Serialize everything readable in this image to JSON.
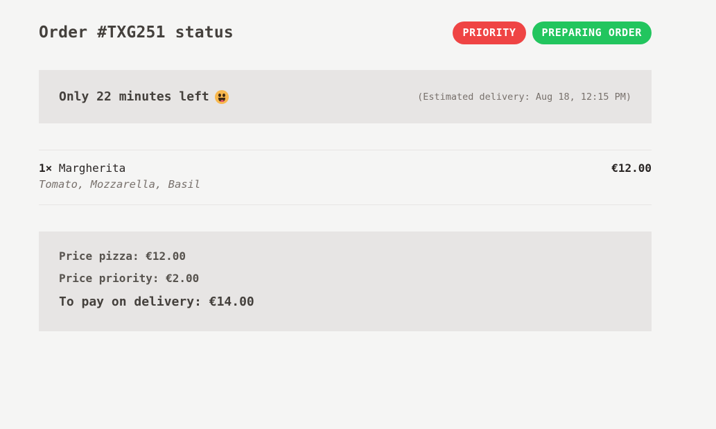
{
  "header": {
    "title": "Order #TXG251 status",
    "badges": {
      "priority": "PRIORITY",
      "status": "PREPARING ORDER"
    }
  },
  "countdown": {
    "text": "Only 22 minutes left",
    "emoji_icon": "grinning-face-emoji",
    "estimate": "(Estimated delivery: Aug 18, 12:15 PM)"
  },
  "items": [
    {
      "quantity": "1×",
      "name": "Margherita",
      "ingredients": "Tomato, Mozzarella, Basil",
      "price": "€12.00"
    }
  ],
  "summary": {
    "price_pizza": "Price pizza: €12.00",
    "price_priority": "Price priority: €2.00",
    "total": "To pay on delivery: €14.00"
  },
  "colors": {
    "background": "#f5f5f4",
    "panel": "#e7e5e4",
    "priority_badge": "#ef4444",
    "status_badge": "#22c55e"
  }
}
